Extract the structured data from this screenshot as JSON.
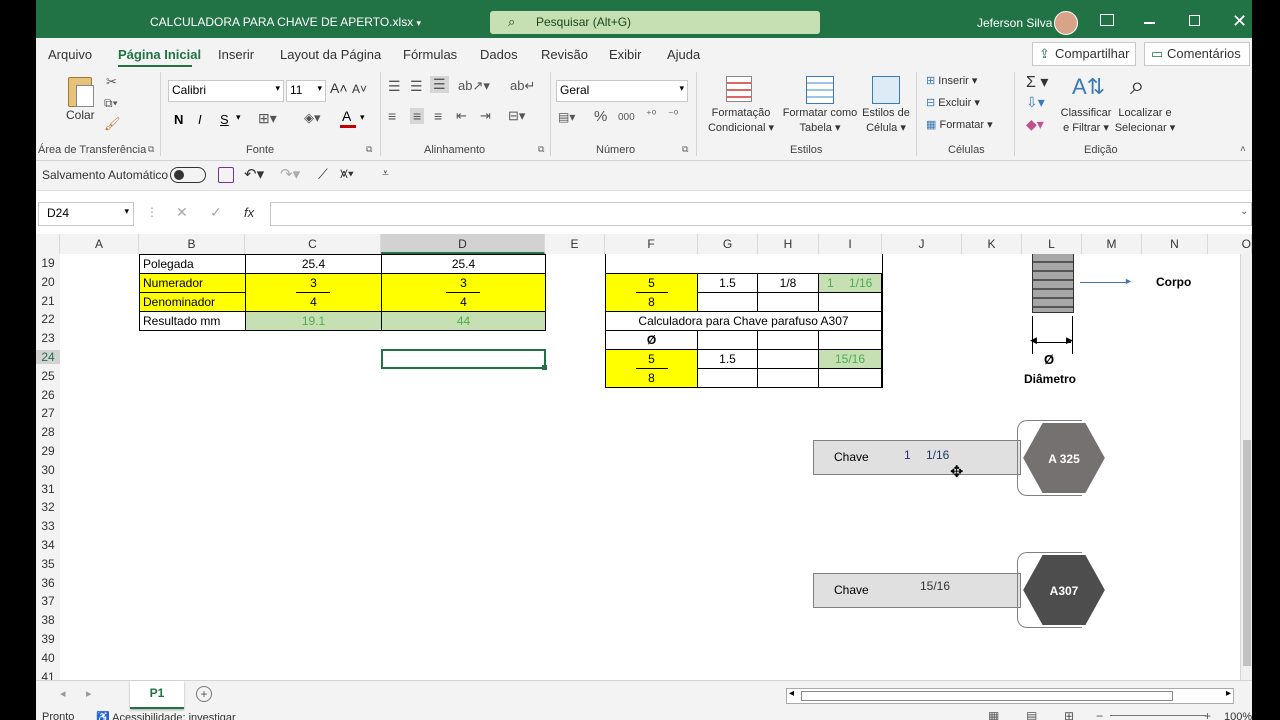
{
  "titlebar": {
    "filename": "CALCULADORA PARA CHAVE DE APERTO.xlsx",
    "search_placeholder": "Pesquisar (Alt+G)",
    "user": "Jeferson Silva"
  },
  "tabs": [
    "Arquivo",
    "Página Inicial",
    "Inserir",
    "Layout da Página",
    "Fórmulas",
    "Dados",
    "Revisão",
    "Exibir",
    "Ajuda"
  ],
  "share_label": "Compartilhar",
  "comments_label": "Comentários",
  "ribbon": {
    "paste_label": "Colar",
    "clipboard_group": "Área de Transferência",
    "font_name": "Calibri",
    "font_size": "11",
    "font_group": "Fonte",
    "bold": "N",
    "italic": "I",
    "underline": "S",
    "align_group": "Alinhamento",
    "number_format": "Geral",
    "number_group": "Número",
    "cond_format": [
      "Formatação",
      "Condicional"
    ],
    "format_table": [
      "Formatar como",
      "Tabela"
    ],
    "cell_styles": [
      "Estilos de",
      "Célula"
    ],
    "styles_group": "Estilos",
    "insert": "Inserir",
    "delete": "Excluir",
    "format": "Formatar",
    "cells_group": "Células",
    "sort_filter": [
      "Classificar",
      "e Filtrar"
    ],
    "find_select": [
      "Localizar e",
      "Selecionar"
    ],
    "edit_group": "Edição"
  },
  "qat": {
    "autosave": "Salvamento Automático"
  },
  "formula_bar": {
    "cell_ref": "D24",
    "fx": "fx"
  },
  "columns": [
    "A",
    "B",
    "C",
    "D",
    "E",
    "F",
    "G",
    "H",
    "I",
    "J",
    "K",
    "L",
    "M",
    "N",
    "O"
  ],
  "rows": [
    "19",
    "20",
    "21",
    "22",
    "23",
    "24",
    "25",
    "26",
    "27",
    "28",
    "29",
    "30",
    "31",
    "32",
    "33",
    "34",
    "35",
    "36",
    "37",
    "38",
    "39",
    "40",
    "41"
  ],
  "table1": {
    "r19": {
      "b": "Polegada",
      "c": "25.4",
      "d": "25.4"
    },
    "r20": {
      "b": "Numerador",
      "c": "3",
      "d": "3"
    },
    "r21": {
      "b": "Denominador",
      "c": "4",
      "d": "4"
    },
    "r22": {
      "b": "Resultado mm",
      "c": "19.1",
      "d": "44"
    }
  },
  "table2": {
    "f20": "5",
    "g20": "1.5",
    "h20": "1/8",
    "i20_a": "1",
    "i20_b": "1/16",
    "f21": "8",
    "title22": "Calculadora para Chave  parafuso A307",
    "f23": "Ø",
    "f24": "5",
    "g24": "1.5",
    "i24": "15/16",
    "f25": "8"
  },
  "diagram": {
    "corpo": "Corpo",
    "diam_symbol": "Ø",
    "diam_label": "Diâmetro",
    "key1_label": "Chave",
    "key1_a": "1",
    "key1_b": "1/16",
    "bolt1": "A 325",
    "key2_label": "Chave",
    "key2_val": "15/16",
    "bolt2": "A307"
  },
  "sheet_tab": "P1",
  "status": {
    "ready": "Pronto",
    "accessibility": "Acessibilidade: investigar",
    "zoom": "100%"
  }
}
